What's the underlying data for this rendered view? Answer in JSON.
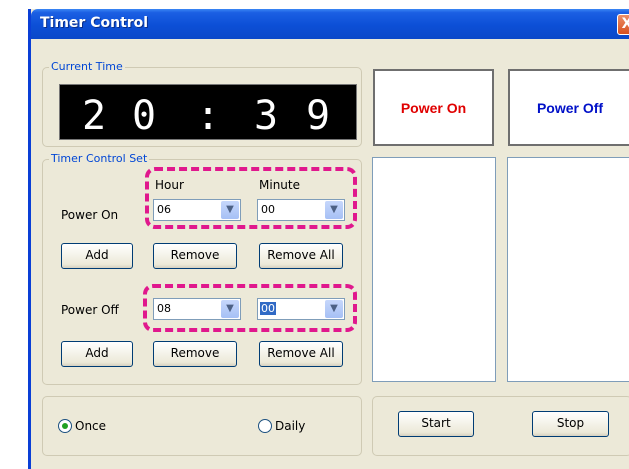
{
  "window": {
    "title": "Timer Control",
    "close_glyph": "X"
  },
  "current_time": {
    "group_label": "Current Time",
    "hour_d1": "2",
    "hour_d2": "0",
    "separator": ":",
    "min_d1": "3",
    "min_d2": "9"
  },
  "power_buttons": {
    "on_label": "Power On",
    "on_color": "#e00000",
    "off_label": "Power Off",
    "off_color": "#0010c8"
  },
  "timer_set": {
    "group_label": "Timer Control Set",
    "hour_header": "Hour",
    "minute_header": "Minute",
    "power_on": {
      "label": "Power On",
      "hour_value": "06",
      "minute_value": "00",
      "add_label": "Add",
      "remove_label": "Remove",
      "remove_all_label": "Remove All"
    },
    "power_off": {
      "label": "Power Off",
      "hour_value": "08",
      "minute_value": "00",
      "add_label": "Add",
      "remove_label": "Remove",
      "remove_all_label": "Remove All"
    }
  },
  "schedule": {
    "once_label": "Once",
    "once_selected": true,
    "daily_label": "Daily",
    "daily_selected": false
  },
  "controls": {
    "start_label": "Start",
    "stop_label": "Stop"
  },
  "colors": {
    "highlight": "#e0188d",
    "titlebar": "#0c4fd6",
    "group_label": "#0046d5"
  }
}
